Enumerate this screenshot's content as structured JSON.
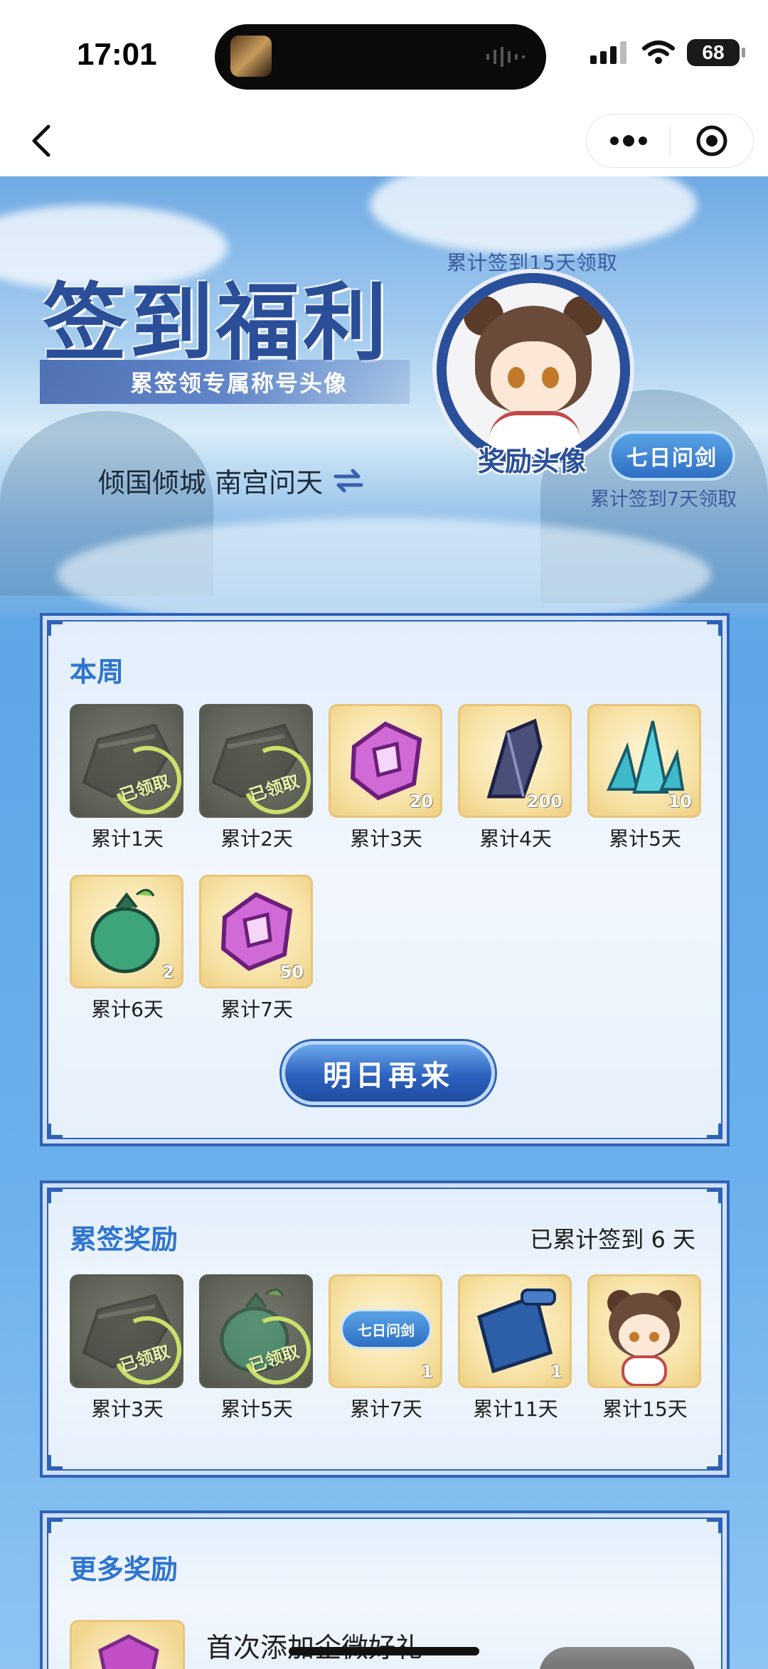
{
  "status_bar": {
    "time": "17:01",
    "battery": "68"
  },
  "hero": {
    "title": "签到福利",
    "subtitle": "累签领专属称号头像",
    "user_line": "倾国倾城 南宫问天",
    "avatar_caption_top": "累计签到15天领取",
    "avatar_label": "奖励头像",
    "title_badge": "七日问剑",
    "avatar_caption_bottom": "累计签到7天领取"
  },
  "this_week": {
    "title": "本周",
    "button": "明日再来",
    "claimed_stamp": "已领取",
    "items": [
      {
        "label": "累计1天",
        "claimed": true,
        "qty": "",
        "icon": "armor-icon"
      },
      {
        "label": "累计2天",
        "claimed": true,
        "qty": "",
        "icon": "armor-icon"
      },
      {
        "label": "累计3天",
        "claimed": false,
        "qty": "20",
        "icon": "purple-jade-icon"
      },
      {
        "label": "累计4天",
        "claimed": false,
        "qty": "200",
        "icon": "dark-crystal-icon"
      },
      {
        "label": "累计5天",
        "claimed": false,
        "qty": "10",
        "icon": "teal-crystal-icon"
      },
      {
        "label": "累计6天",
        "claimed": false,
        "qty": "2",
        "icon": "green-pouch-icon"
      },
      {
        "label": "累计7天",
        "claimed": false,
        "qty": "50",
        "icon": "purple-jade-icon"
      }
    ]
  },
  "cumulative": {
    "title": "累签奖励",
    "progress": "已累计签到 6 天",
    "claimed_stamp": "已领取",
    "items": [
      {
        "label": "累计3天",
        "claimed": true,
        "qty": "",
        "icon": "armor-icon"
      },
      {
        "label": "累计5天",
        "claimed": true,
        "qty": "",
        "icon": "green-pouch-icon"
      },
      {
        "label": "累计7天",
        "claimed": false,
        "qty": "1",
        "icon": "title-ticket-icon",
        "ticket_text": "七日问剑"
      },
      {
        "label": "累计11天",
        "claimed": false,
        "qty": "1",
        "icon": "blue-scroll-icon"
      },
      {
        "label": "累计15天",
        "claimed": false,
        "qty": "",
        "icon": "chibi-avatar-icon"
      }
    ]
  },
  "more": {
    "title": "更多奖励",
    "first_item": "首次添加企微好礼"
  },
  "colors": {
    "accent_blue": "#2e74d0",
    "panel_border": "#2f62b6",
    "gold_tile": "#f7e3a8"
  }
}
